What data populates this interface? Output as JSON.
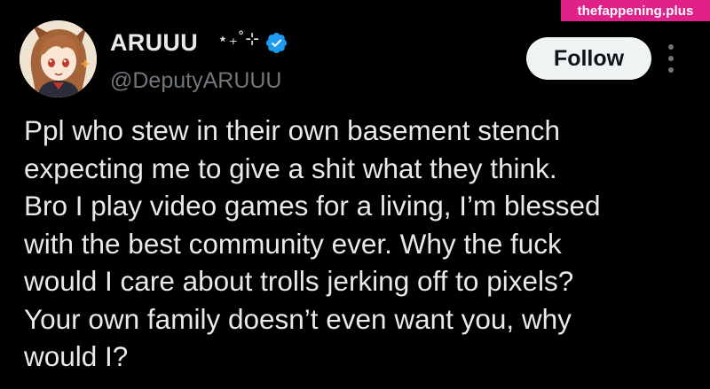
{
  "author": {
    "display_name": "ARUUU",
    "name_decoration": "⋆₊˚⊹",
    "handle": "@DeputyARUUU",
    "verified": true,
    "avatar_icon": "anime-character-avatar"
  },
  "actions": {
    "follow_label": "Follow",
    "more_icon": "vertical-ellipsis-icon"
  },
  "tweet": {
    "text": "Ppl who stew in their own basement stench\nexpecting me to give a shit what they think.\nBro I play video games for a living, I’m blessed\nwith the best community ever. Why the fuck\nwould I care about trolls jerking off to pixels?\nYour own family doesn’t even want you, why\nwould I?"
  },
  "watermark": {
    "text": "thefappening.plus"
  },
  "colors": {
    "background": "#000000",
    "text_primary": "#e7e9ea",
    "text_secondary": "#71767b",
    "verified_blue": "#1d9bf0",
    "follow_bg": "#eff3f4",
    "watermark_bg": "#e0218a"
  }
}
